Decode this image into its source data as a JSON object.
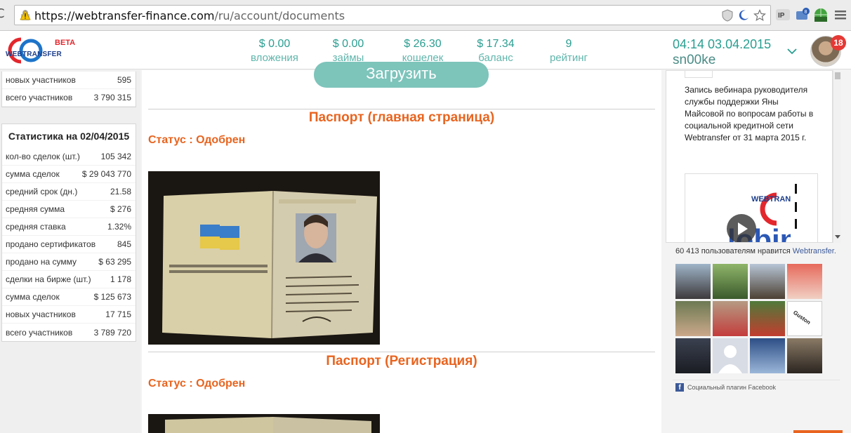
{
  "browser": {
    "url_host": "https://webtransfer-finance.com",
    "url_path": "/ru/account/documents"
  },
  "header": {
    "beta": "BETA",
    "logo_text": "WEBTRANSFER",
    "stats": [
      {
        "value": "$ 0.00",
        "label": "вложения"
      },
      {
        "value": "$ 0.00",
        "label": "займы"
      },
      {
        "value": "$ 26.30",
        "label": "кошелек"
      },
      {
        "value": "$ 17.34",
        "label": "баланс"
      },
      {
        "value": "9",
        "label": "рейтинг"
      }
    ],
    "datetime": "04:14 03.04.2015",
    "username": "sn00ke",
    "notifications": "18"
  },
  "sidebar": {
    "top_rows": [
      {
        "label": "новых участников",
        "value": "595"
      },
      {
        "label": "всего участников",
        "value": "3 790 315"
      }
    ],
    "stats_title": "Статистика на 02/04/2015",
    "stats_rows": [
      {
        "label": "кол-во сделок (шт.)",
        "value": "105 342"
      },
      {
        "label": "сумма сделок",
        "value": "$ 29 043 770"
      },
      {
        "label": "средний срок (дн.)",
        "value": "21.58"
      },
      {
        "label": "средняя сумма",
        "value": "$ 276"
      },
      {
        "label": "средняя ставка",
        "value": "1.32%"
      },
      {
        "label": "продано сертификатов",
        "value": "845"
      },
      {
        "label": "продано на сумму",
        "value": "$ 63 295"
      },
      {
        "label": "сделки на бирже (шт.)",
        "value": "1 178"
      },
      {
        "label": "сумма сделок",
        "value": "$ 125 673"
      },
      {
        "label": "новых участников",
        "value": "17 715"
      },
      {
        "label": "всего участников",
        "value": "3 789 720"
      }
    ]
  },
  "main": {
    "upload_label": "Загрузить",
    "documents": [
      {
        "title": "Паспорт (главная страница)",
        "status": "Статус : Одобрен"
      },
      {
        "title": "Паспорт (Регистрация)",
        "status": "Статус : Одобрен"
      }
    ]
  },
  "facebook": {
    "post_text": "Запись вебинара руководителя службы поддержки Яны Майсовой по вопросам работы в социальной кредитной сети Webtransfer от 31 марта 2015 г.",
    "likes_count": "60 413 пользователям нравится",
    "likes_page": "Webtransfer.",
    "plugin_label": "Социальный плагин Facebook",
    "face_label": "Guston"
  },
  "colors": {
    "teal": "#2a9e91",
    "orange": "#e8641f",
    "facebook": "#3b5998"
  }
}
